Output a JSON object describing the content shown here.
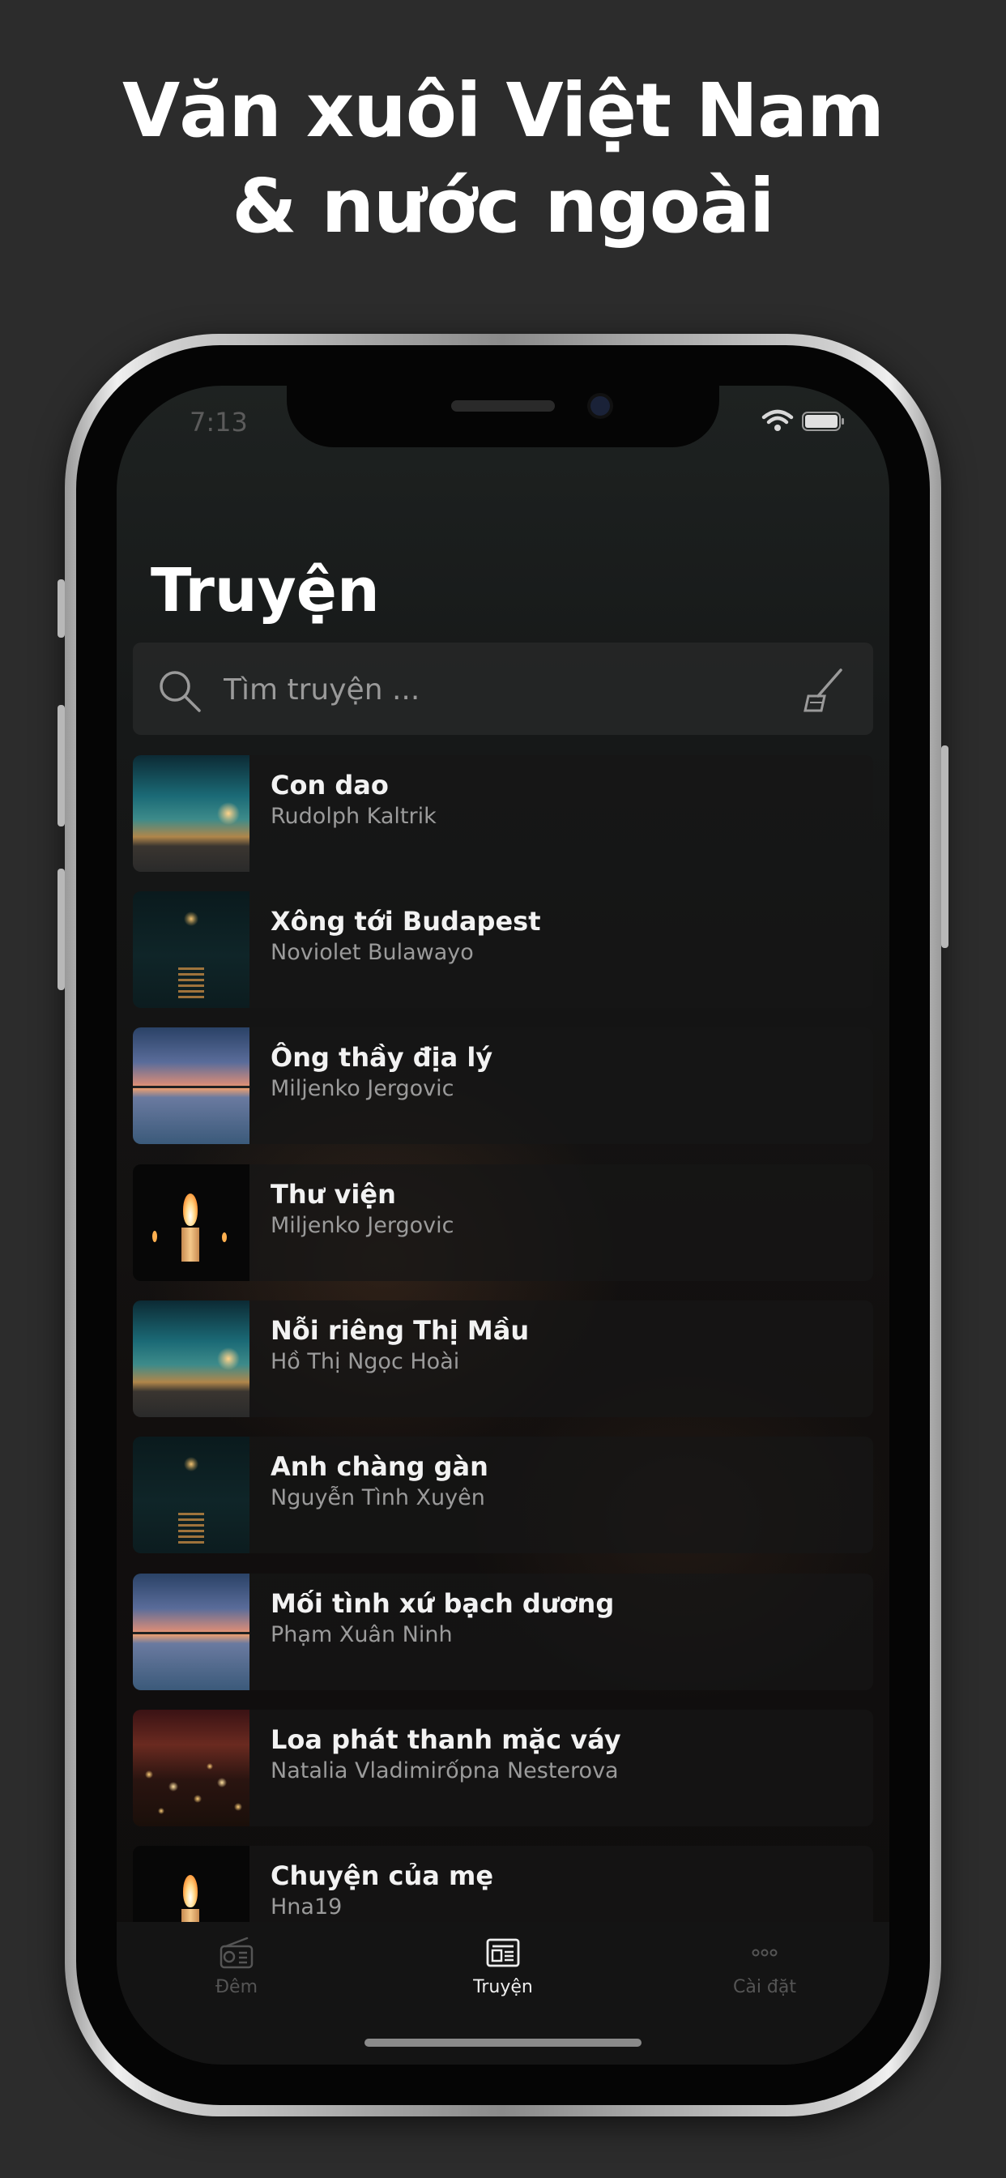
{
  "promo": {
    "headline_line1": "Văn xuôi Việt Nam",
    "headline_line2": "& nước ngoài"
  },
  "status_bar": {
    "time": "7:13"
  },
  "header": {
    "title": "Truyện"
  },
  "search": {
    "placeholder": "Tìm truyện ..."
  },
  "stories": [
    {
      "title": "Con dao",
      "author": "Rudolph Kaltrik",
      "thumb": "landscape"
    },
    {
      "title": "Xông tới Budapest",
      "author": "Noviolet Bulawayo",
      "thumb": "moon"
    },
    {
      "title": "Ông thầy địa lý",
      "author": "Miljenko Jergovic",
      "thumb": "sunset"
    },
    {
      "title": "Thư viện",
      "author": "Miljenko Jergovic",
      "thumb": "candle"
    },
    {
      "title": "Nỗi riêng Thị Mầu",
      "author": "Hồ Thị Ngọc Hoài",
      "thumb": "landscape"
    },
    {
      "title": "Anh chàng gàn",
      "author": "Nguyễn Tình Xuyên",
      "thumb": "moon"
    },
    {
      "title": "Mối tình xứ bạch dương",
      "author": "Phạm Xuân Ninh",
      "thumb": "sunset"
    },
    {
      "title": "Loa phát thanh mặc váy",
      "author": "Natalia Vladimirốpna Nesterova",
      "thumb": "lanterns"
    },
    {
      "title": "Chuyện của mẹ",
      "author": "Hna19",
      "thumb": "candle"
    }
  ],
  "tabs": [
    {
      "label": "Đêm",
      "icon": "radio-icon",
      "active": false
    },
    {
      "label": "Truyện",
      "icon": "newspaper-icon",
      "active": true
    },
    {
      "label": "Cài đặt",
      "icon": "more-icon",
      "active": false
    }
  ],
  "colors": {
    "background": "#2c2c2c",
    "text_primary": "#ffffff",
    "text_secondary": "#9b9b9b"
  }
}
